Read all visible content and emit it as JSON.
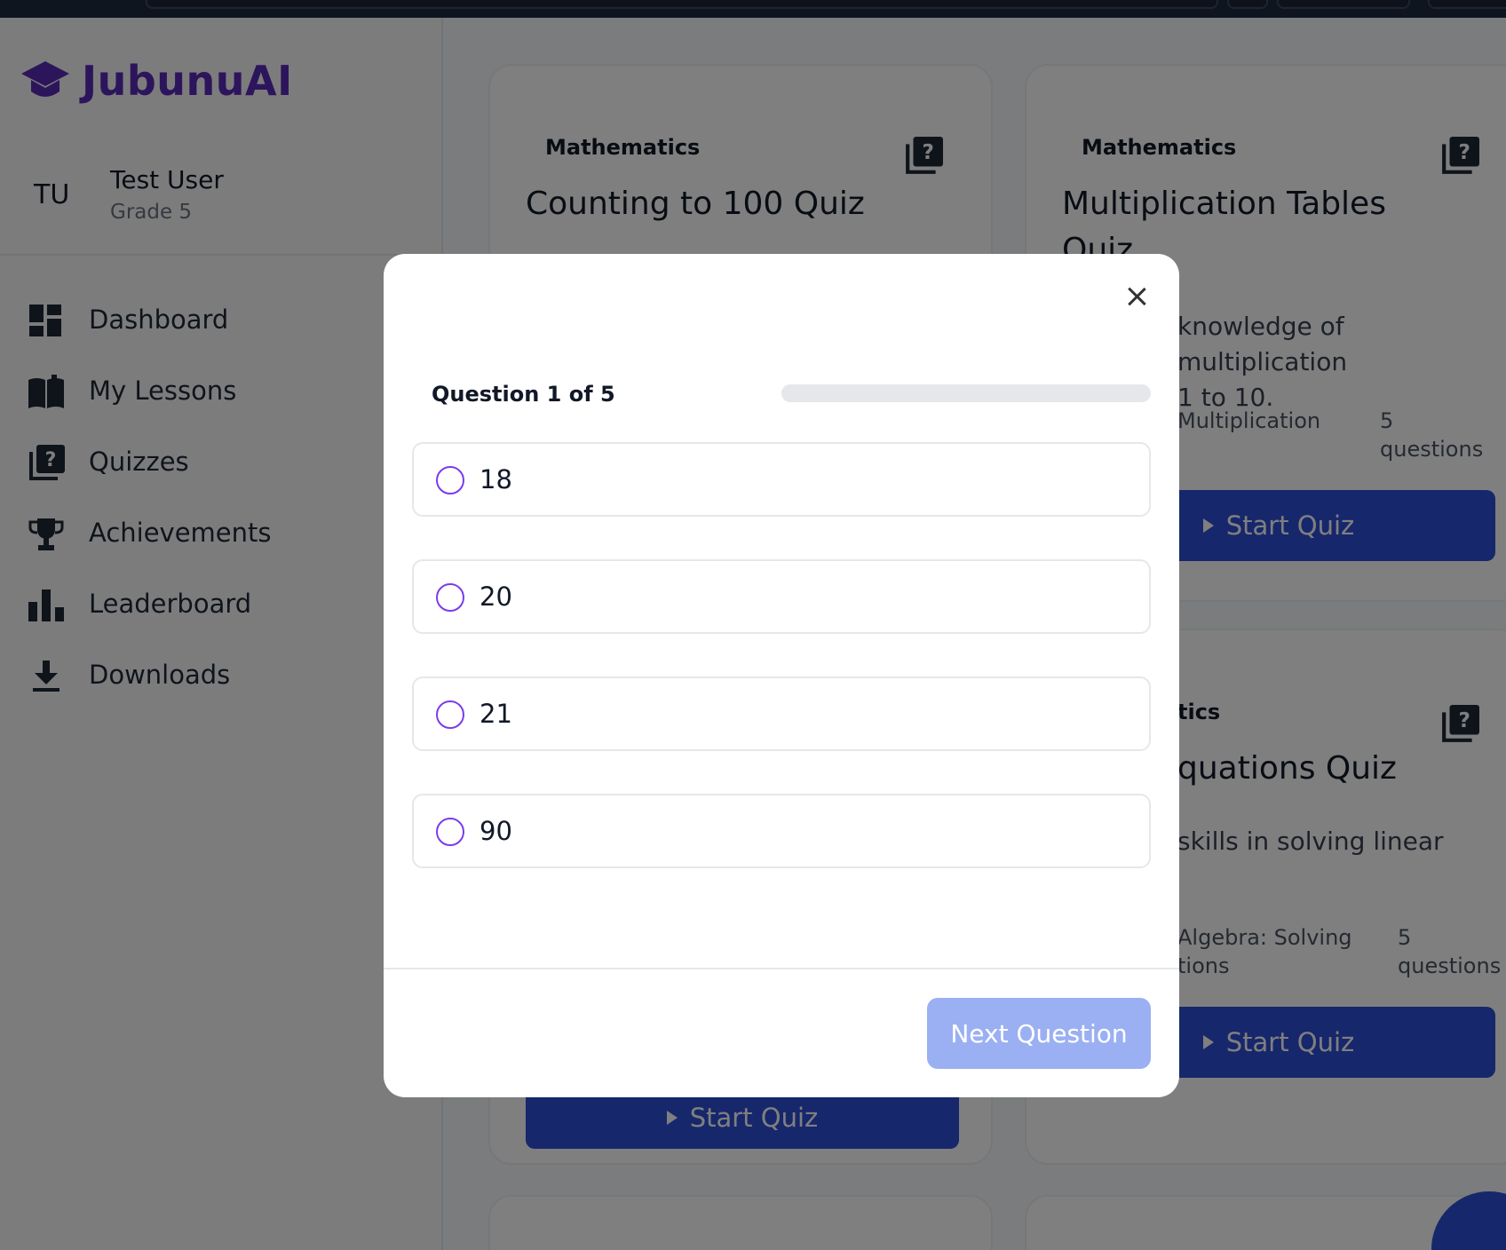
{
  "app": {
    "brand": "JubunuAI"
  },
  "user": {
    "initials": "TU",
    "name": "Test User",
    "grade": "Grade 5"
  },
  "nav": {
    "items": [
      {
        "label": "Dashboard",
        "icon": "dashboard-icon"
      },
      {
        "label": "My Lessons",
        "icon": "book-icon"
      },
      {
        "label": "Quizzes",
        "icon": "quiz-icon"
      },
      {
        "label": "Achievements",
        "icon": "trophy-icon"
      },
      {
        "label": "Leaderboard",
        "icon": "bar-chart-icon"
      },
      {
        "label": "Downloads",
        "icon": "download-icon"
      }
    ]
  },
  "cards": [
    {
      "subject": "Mathematics",
      "title": "Counting to 100 Quiz",
      "button": "Start Quiz"
    },
    {
      "subject": "Mathematics",
      "title_line1": "Multiplication Tables",
      "title_line2": "Quiz",
      "desc_line1": "knowledge of multiplication",
      "desc_line2": "1 to 10.",
      "topic": "Multiplication",
      "count_line1": "5",
      "count_line2": "questions",
      "button": "Start Quiz"
    },
    {
      "subject": "tics",
      "title": "quations Quiz",
      "desc": "skills in solving linear",
      "topic_line1": "Algebra: Solving",
      "topic_line2": "tions",
      "count_line1": "5",
      "count_line2": "questions",
      "button": "Start Quiz"
    }
  ],
  "modal": {
    "question_label": "Question 1 of 5",
    "progress": 0,
    "options": [
      "18",
      "20",
      "21",
      "90"
    ],
    "next_label": "Next Question"
  },
  "colors": {
    "brand": "#5b2bb8",
    "primary": "#2f4fd8",
    "radio": "#7c3aed",
    "next_disabled": "#9bb0f2"
  }
}
